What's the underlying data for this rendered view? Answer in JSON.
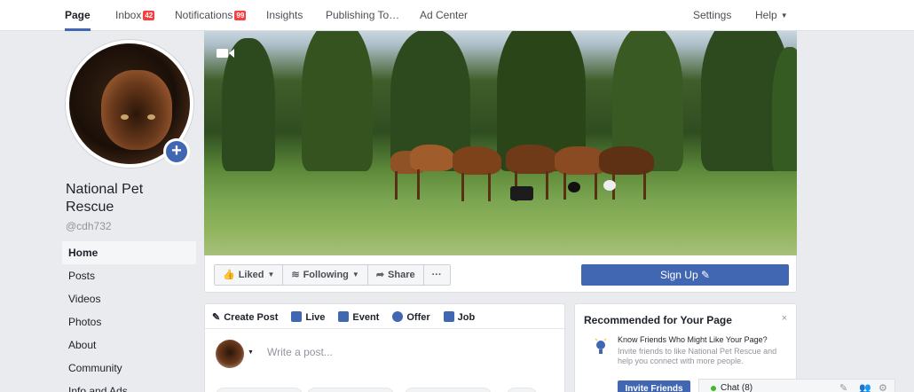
{
  "topnav": {
    "page": "Page",
    "inbox": "Inbox",
    "inbox_count": "42",
    "notifications": "Notifications",
    "notifications_count": "99",
    "insights": "Insights",
    "publishing": "Publishing To…",
    "ad_center": "Ad Center",
    "settings": "Settings",
    "help": "Help"
  },
  "profile": {
    "name": "National Pet Rescue",
    "handle": "@cdh732"
  },
  "sidebar": {
    "items": [
      {
        "label": "Home"
      },
      {
        "label": "Posts"
      },
      {
        "label": "Videos"
      },
      {
        "label": "Photos"
      },
      {
        "label": "About"
      },
      {
        "label": "Community"
      },
      {
        "label": "Info and Ads"
      }
    ]
  },
  "actions": {
    "liked": "Liked",
    "following": "Following",
    "share": "Share",
    "more": "···",
    "signup": "Sign Up"
  },
  "composer": {
    "tabs": [
      {
        "label": "Create Post"
      },
      {
        "label": "Live"
      },
      {
        "label": "Event"
      },
      {
        "label": "Offer"
      },
      {
        "label": "Job"
      }
    ],
    "placeholder": "Write a post..."
  },
  "recommended": {
    "title": "Recommended for Your Page",
    "close": "×",
    "heading": "Know Friends Who Might Like Your Page?",
    "body": "Invite friends to like National Pet Rescue and help you connect with more people.",
    "button": "Invite Friends"
  },
  "chat": {
    "label": "Chat (8)"
  },
  "colors": {
    "brand": "#4267b2",
    "badge": "#fa3e3e",
    "online": "#42b72a",
    "background": "#e9ebee"
  }
}
